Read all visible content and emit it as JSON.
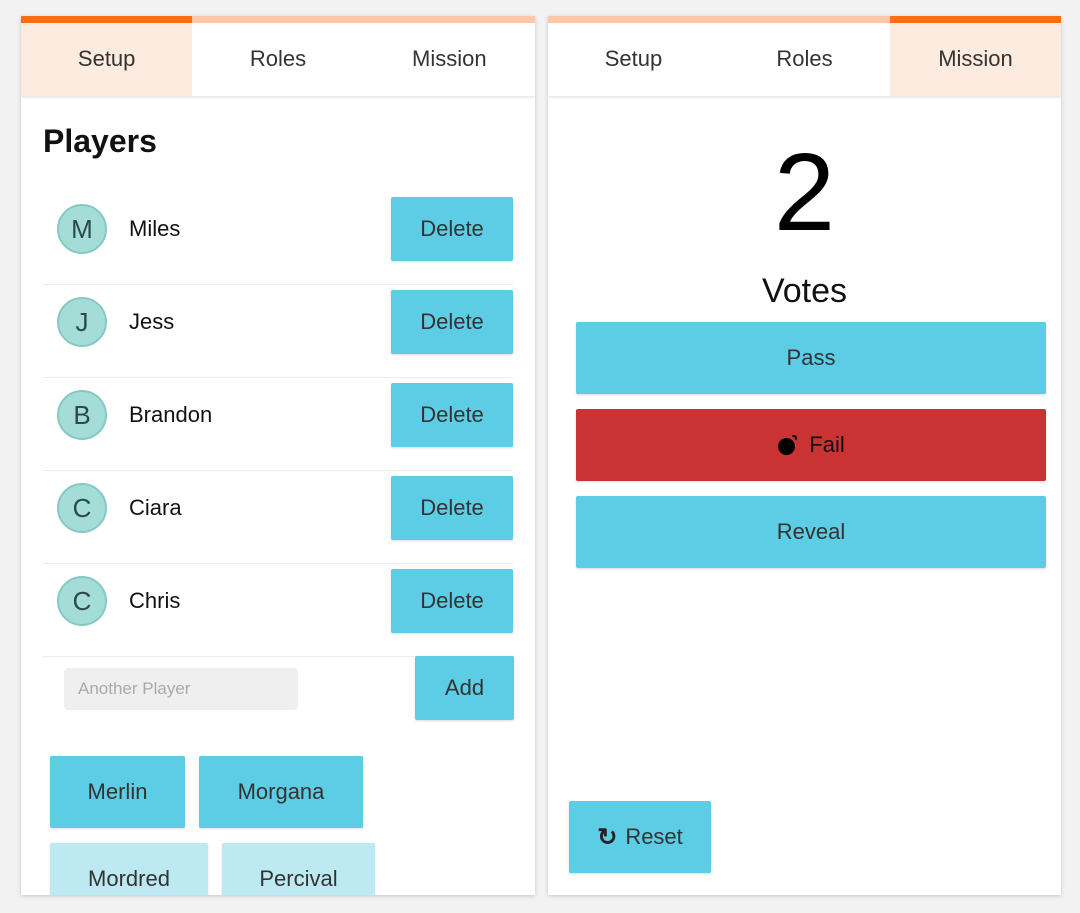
{
  "left_panel": {
    "tabs": [
      {
        "label": "Setup",
        "active": true
      },
      {
        "label": "Roles",
        "active": false
      },
      {
        "label": "Mission",
        "active": false
      }
    ],
    "players_title": "Players",
    "players": [
      {
        "initial": "M",
        "name": "Miles",
        "delete_label": "Delete"
      },
      {
        "initial": "J",
        "name": "Jess",
        "delete_label": "Delete"
      },
      {
        "initial": "B",
        "name": "Brandon",
        "delete_label": "Delete"
      },
      {
        "initial": "C",
        "name": "Ciara",
        "delete_label": "Delete"
      },
      {
        "initial": "C",
        "name": "Chris",
        "delete_label": "Delete"
      }
    ],
    "add_player": {
      "placeholder": "Another Player",
      "value": "",
      "button_label": "Add"
    },
    "roles": [
      {
        "label": "Merlin",
        "selected": true
      },
      {
        "label": "Morgana",
        "selected": true
      },
      {
        "label": "Mordred",
        "selected": false
      },
      {
        "label": "Percival",
        "selected": false
      }
    ]
  },
  "right_panel": {
    "tabs": [
      {
        "label": "Setup",
        "active": false
      },
      {
        "label": "Roles",
        "active": false
      },
      {
        "label": "Mission",
        "active": true
      }
    ],
    "vote_count": "2",
    "votes_label": "Votes",
    "pass_label": "Pass",
    "fail_label": "Fail",
    "reveal_label": "Reveal",
    "reset_label": "Reset",
    "icons": {
      "fail": "bomb-icon",
      "reset": "refresh-icon"
    }
  },
  "colors": {
    "tab_accent_active": "#ff6f10",
    "tab_accent_inactive": "#ffc8a6",
    "tab_active_bg": "#fdebe0",
    "button_blue": "#5ccde4",
    "button_blue_light": "#bde9f2",
    "fail_red": "#c93333",
    "avatar_teal": "#a4dcd8"
  }
}
